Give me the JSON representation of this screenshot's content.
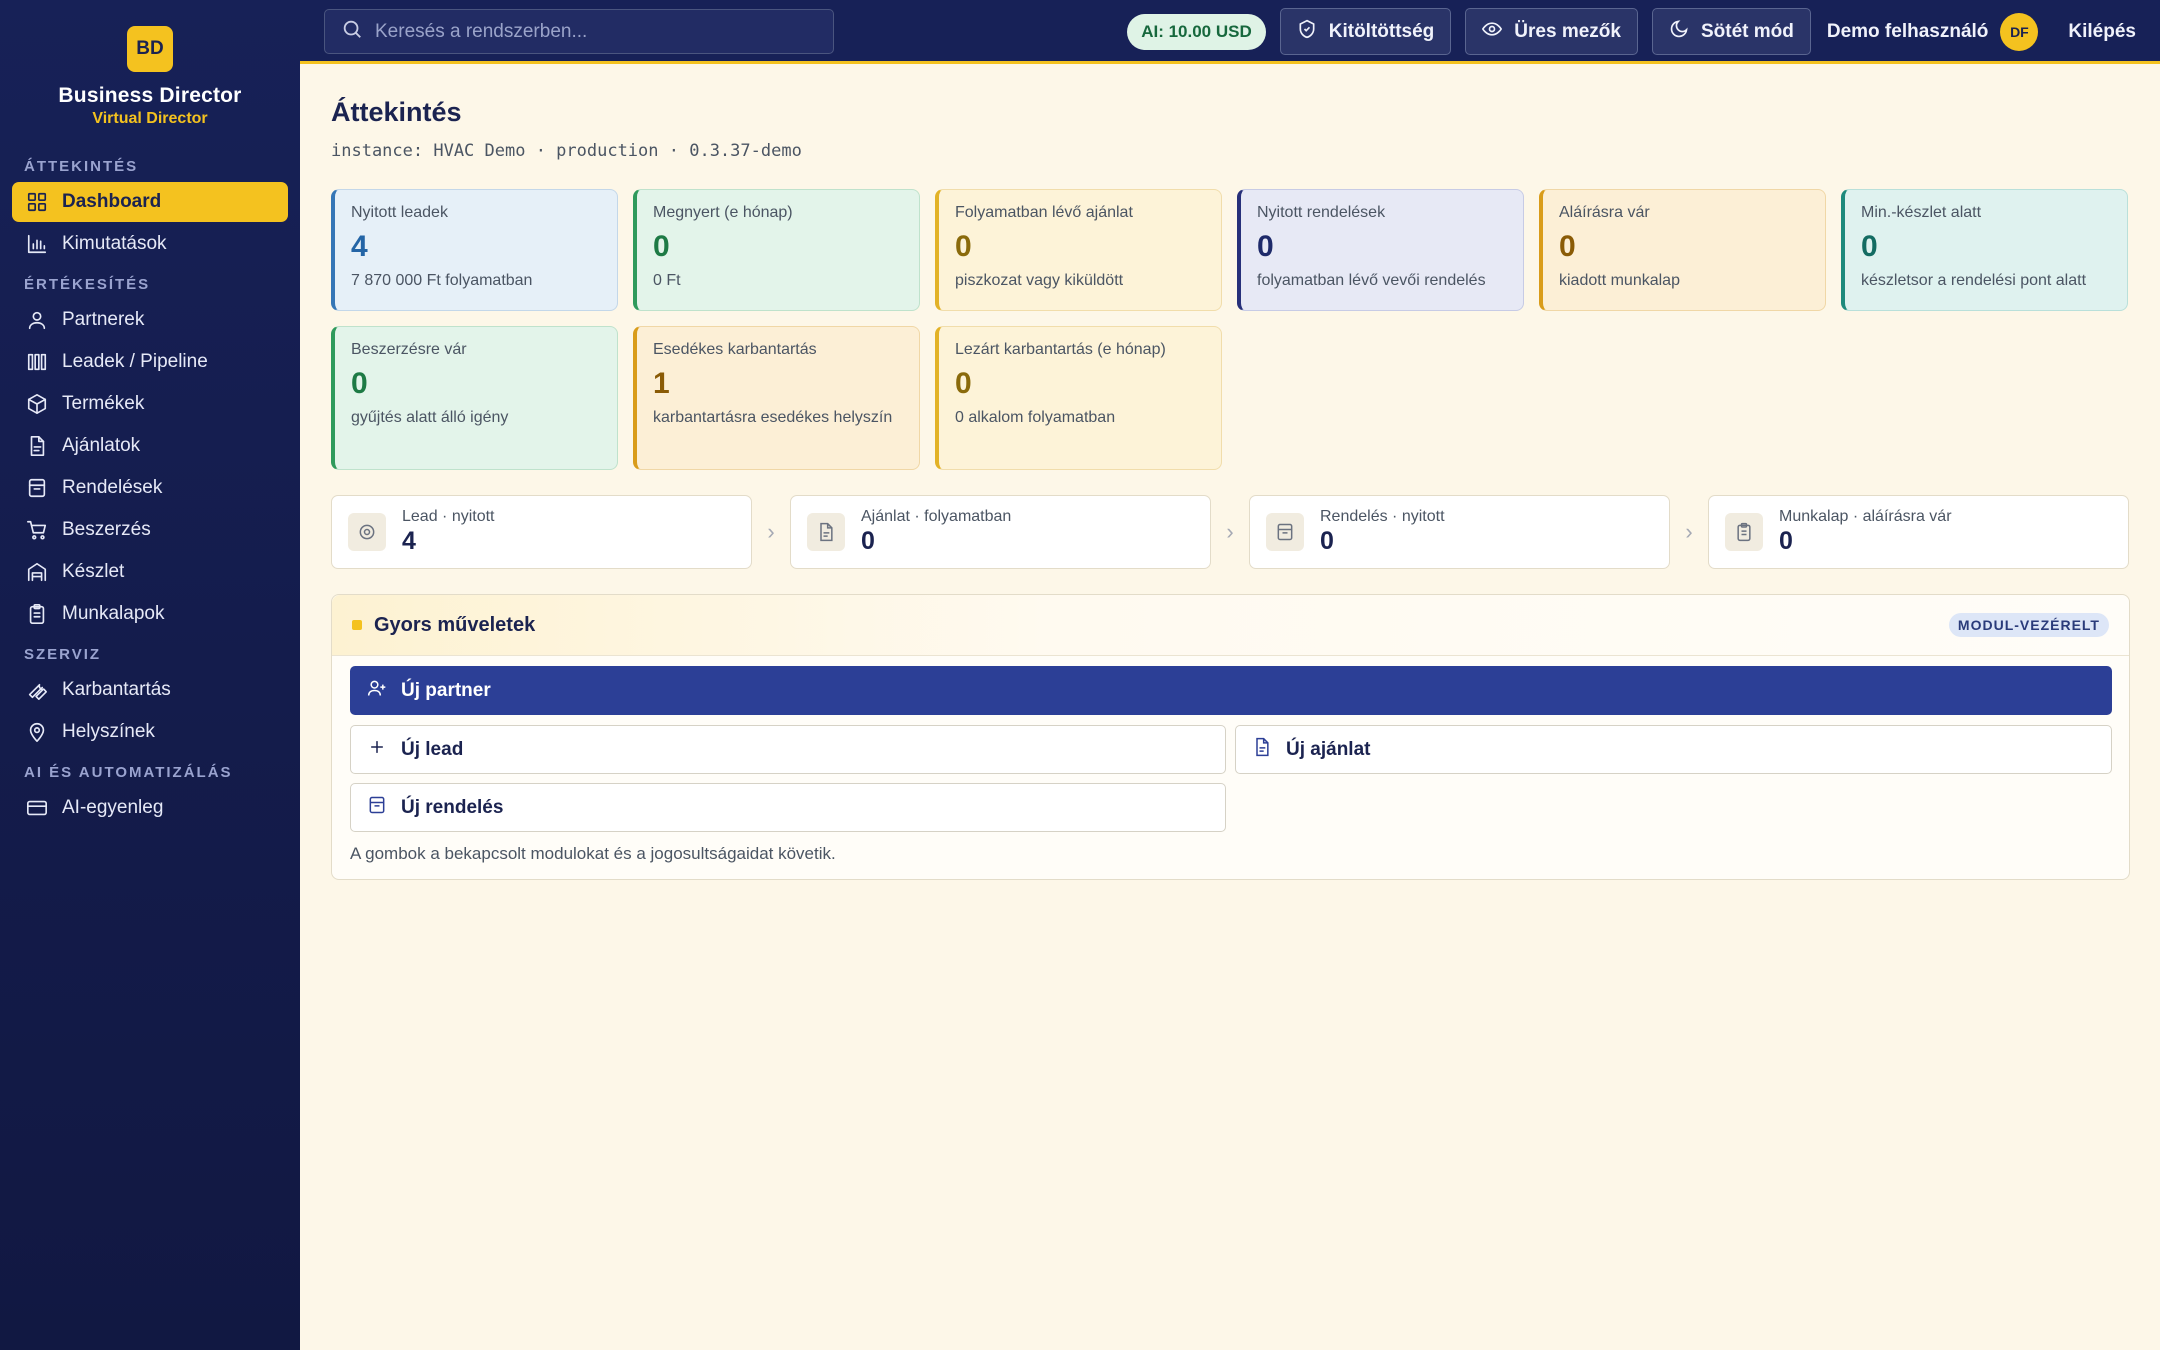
{
  "brand": {
    "logo": "BD",
    "name": "Business Director",
    "sub": "Virtual Director"
  },
  "nav": {
    "sections": [
      {
        "title": "ÁTTEKINTÉS",
        "items": [
          {
            "label": "Dashboard",
            "icon": "grid-icon",
            "active": true
          },
          {
            "label": "Kimutatások",
            "icon": "bar-chart-icon"
          }
        ]
      },
      {
        "title": "ÉRTÉKESÍTÉS",
        "items": [
          {
            "label": "Partnerek",
            "icon": "user-icon"
          },
          {
            "label": "Leadek / Pipeline",
            "icon": "columns-icon"
          },
          {
            "label": "Termékek",
            "icon": "box-icon"
          },
          {
            "label": "Ajánlatok",
            "icon": "document-icon"
          },
          {
            "label": "Rendelések",
            "icon": "order-icon"
          },
          {
            "label": "Beszerzés",
            "icon": "cart-icon"
          },
          {
            "label": "Készlet",
            "icon": "warehouse-icon"
          },
          {
            "label": "Munkalapok",
            "icon": "clipboard-icon"
          }
        ]
      },
      {
        "title": "SZERVIZ",
        "items": [
          {
            "label": "Karbantartás",
            "icon": "wrench-icon"
          },
          {
            "label": "Helyszínek",
            "icon": "map-pin-icon"
          }
        ]
      },
      {
        "title": "AI ÉS AUTOMATIZÁLÁS",
        "items": [
          {
            "label": "AI-egyenleg",
            "icon": "credit-card-icon"
          }
        ]
      }
    ]
  },
  "topbar": {
    "search_placeholder": "Keresés a rendszerben...",
    "ai_balance": "AI: 10.00 USD",
    "completeness": "Kitöltöttség",
    "empty_fields": "Üres mezők",
    "dark_mode": "Sötét mód",
    "user": "Demo felhasználó",
    "avatar": "DF",
    "logout": "Kilépés"
  },
  "page": {
    "title": "Áttekintés",
    "subtitle": "instance: HVAC Demo · production · 0.3.37-demo"
  },
  "kpis": [
    {
      "label": "Nyitott leadek",
      "value": "4",
      "desc": "7 870 000 Ft folyamatban",
      "color": "blue"
    },
    {
      "label": "Megnyert (e hónap)",
      "value": "0",
      "desc": "0 Ft",
      "color": "green"
    },
    {
      "label": "Folyamatban lévő ajánlat",
      "value": "0",
      "desc": "piszkozat vagy kiküldött",
      "color": "yellow"
    },
    {
      "label": "Nyitott rendelések",
      "value": "0",
      "desc": "folyamatban lévő vevői rendelés",
      "color": "indigo"
    },
    {
      "label": "Aláírásra vár",
      "value": "0",
      "desc": "kiadott munkalap",
      "color": "amber"
    },
    {
      "label": "Min.-készlet alatt",
      "value": "0",
      "desc": "készletsor a rendelési pont alatt",
      "color": "teal"
    },
    {
      "label": "Beszerzésre vár",
      "value": "0",
      "desc": "gyűjtés alatt álló igény",
      "color": "green"
    },
    {
      "label": "Esedékes karbantartás",
      "value": "1",
      "desc": "karbantartásra esedékes helyszín",
      "color": "amber"
    },
    {
      "label": "Lezárt karbantartás (e hónap)",
      "value": "0",
      "desc": "0 alkalom folyamatban",
      "color": "yellow"
    }
  ],
  "pipeline": [
    {
      "label": "Lead · nyitott",
      "value": "4",
      "icon": "target-icon"
    },
    {
      "label": "Ajánlat · folyamatban",
      "value": "0",
      "icon": "document-icon"
    },
    {
      "label": "Rendelés · nyitott",
      "value": "0",
      "icon": "order-icon"
    },
    {
      "label": "Munkalap · aláírásra vár",
      "value": "0",
      "icon": "clipboard-icon"
    }
  ],
  "quick": {
    "title": "Gyors műveletek",
    "badge": "MODUL-VEZÉRELT",
    "new_partner": "Új partner",
    "new_lead": "Új lead",
    "new_offer": "Új ajánlat",
    "new_order": "Új rendelés",
    "note": "A gombok a bekapcsolt modulokat és a jogosultságaidat követik."
  }
}
